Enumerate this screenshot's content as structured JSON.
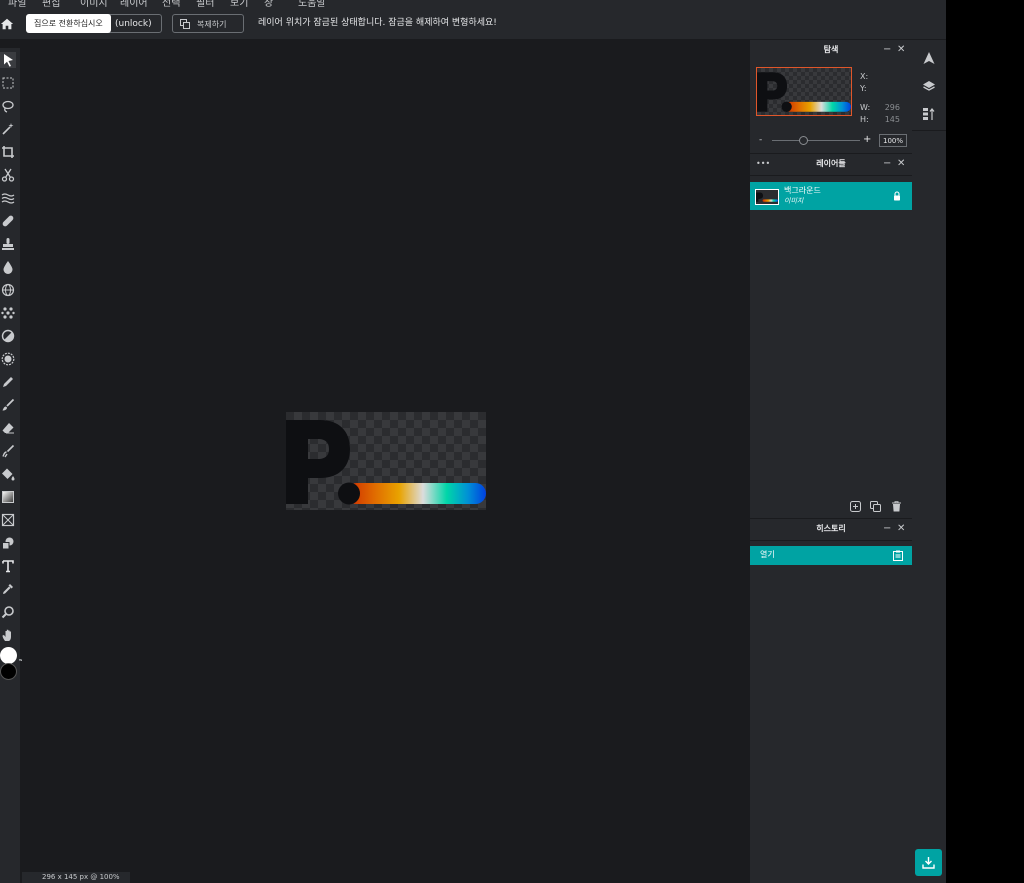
{
  "menubar": {
    "items": [
      "파일",
      "편집",
      "이미지",
      "레이어",
      "선택",
      "필터",
      "보기",
      "창",
      "도움말"
    ]
  },
  "topbar": {
    "tooltip": "집으로 전환하십시오",
    "unlock_label": "(unlock)",
    "duplicate_label": "복제하기",
    "lock_message": "레이어 위치가 잠금된 상태합니다. 잠금을 해제하여 변형하세요!"
  },
  "navigator": {
    "title": "탐색",
    "x_label": "X:",
    "y_label": "Y:",
    "w_label": "W:",
    "h_label": "H:",
    "w_value": "296",
    "h_value": "145",
    "zoom_minus": "-",
    "zoom_plus": "+",
    "zoom_value": "100%",
    "slider_level": 0.35
  },
  "layers": {
    "more": "•••",
    "title": "레이어들",
    "items": [
      {
        "name": "백그라운드",
        "type": "이미지",
        "locked": true
      }
    ]
  },
  "history": {
    "title": "히스토리",
    "items": [
      {
        "label": "열기"
      }
    ]
  },
  "status": {
    "text": "296 x 145 px @ 100%"
  },
  "colors": {
    "accent": "#00a3a3",
    "panel": "#26282c",
    "workspace": "#1a1b1e",
    "foreground": "#ffffff",
    "background": "#000000"
  },
  "image_gradient": [
    "#cc2a00",
    "#e06a00",
    "#e9a300",
    "#dcdcdc",
    "#00d6a8",
    "#0091d6",
    "#0040e0"
  ]
}
